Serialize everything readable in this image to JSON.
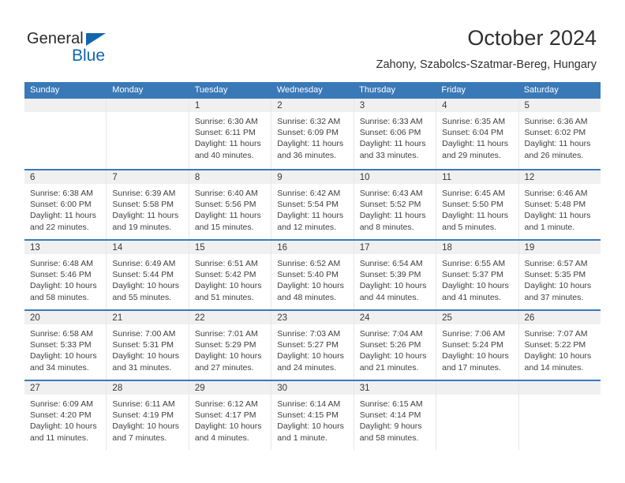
{
  "brand": {
    "name_part1": "General",
    "name_part2": "Blue"
  },
  "header": {
    "title": "October 2024",
    "subtitle": "Zahony, Szabolcs-Szatmar-Bereg, Hungary"
  },
  "calendar": {
    "weekdays": [
      "Sunday",
      "Monday",
      "Tuesday",
      "Wednesday",
      "Thursday",
      "Friday",
      "Saturday"
    ],
    "header_bg": "#3a79b8",
    "daynum_bg": "#f0f0f0",
    "weeks": [
      [
        {
          "day": "",
          "sunrise": "",
          "sunset": "",
          "daylight": ""
        },
        {
          "day": "",
          "sunrise": "",
          "sunset": "",
          "daylight": ""
        },
        {
          "day": "1",
          "sunrise": "Sunrise: 6:30 AM",
          "sunset": "Sunset: 6:11 PM",
          "daylight": "Daylight: 11 hours and 40 minutes."
        },
        {
          "day": "2",
          "sunrise": "Sunrise: 6:32 AM",
          "sunset": "Sunset: 6:09 PM",
          "daylight": "Daylight: 11 hours and 36 minutes."
        },
        {
          "day": "3",
          "sunrise": "Sunrise: 6:33 AM",
          "sunset": "Sunset: 6:06 PM",
          "daylight": "Daylight: 11 hours and 33 minutes."
        },
        {
          "day": "4",
          "sunrise": "Sunrise: 6:35 AM",
          "sunset": "Sunset: 6:04 PM",
          "daylight": "Daylight: 11 hours and 29 minutes."
        },
        {
          "day": "5",
          "sunrise": "Sunrise: 6:36 AM",
          "sunset": "Sunset: 6:02 PM",
          "daylight": "Daylight: 11 hours and 26 minutes."
        }
      ],
      [
        {
          "day": "6",
          "sunrise": "Sunrise: 6:38 AM",
          "sunset": "Sunset: 6:00 PM",
          "daylight": "Daylight: 11 hours and 22 minutes."
        },
        {
          "day": "7",
          "sunrise": "Sunrise: 6:39 AM",
          "sunset": "Sunset: 5:58 PM",
          "daylight": "Daylight: 11 hours and 19 minutes."
        },
        {
          "day": "8",
          "sunrise": "Sunrise: 6:40 AM",
          "sunset": "Sunset: 5:56 PM",
          "daylight": "Daylight: 11 hours and 15 minutes."
        },
        {
          "day": "9",
          "sunrise": "Sunrise: 6:42 AM",
          "sunset": "Sunset: 5:54 PM",
          "daylight": "Daylight: 11 hours and 12 minutes."
        },
        {
          "day": "10",
          "sunrise": "Sunrise: 6:43 AM",
          "sunset": "Sunset: 5:52 PM",
          "daylight": "Daylight: 11 hours and 8 minutes."
        },
        {
          "day": "11",
          "sunrise": "Sunrise: 6:45 AM",
          "sunset": "Sunset: 5:50 PM",
          "daylight": "Daylight: 11 hours and 5 minutes."
        },
        {
          "day": "12",
          "sunrise": "Sunrise: 6:46 AM",
          "sunset": "Sunset: 5:48 PM",
          "daylight": "Daylight: 11 hours and 1 minute."
        }
      ],
      [
        {
          "day": "13",
          "sunrise": "Sunrise: 6:48 AM",
          "sunset": "Sunset: 5:46 PM",
          "daylight": "Daylight: 10 hours and 58 minutes."
        },
        {
          "day": "14",
          "sunrise": "Sunrise: 6:49 AM",
          "sunset": "Sunset: 5:44 PM",
          "daylight": "Daylight: 10 hours and 55 minutes."
        },
        {
          "day": "15",
          "sunrise": "Sunrise: 6:51 AM",
          "sunset": "Sunset: 5:42 PM",
          "daylight": "Daylight: 10 hours and 51 minutes."
        },
        {
          "day": "16",
          "sunrise": "Sunrise: 6:52 AM",
          "sunset": "Sunset: 5:40 PM",
          "daylight": "Daylight: 10 hours and 48 minutes."
        },
        {
          "day": "17",
          "sunrise": "Sunrise: 6:54 AM",
          "sunset": "Sunset: 5:39 PM",
          "daylight": "Daylight: 10 hours and 44 minutes."
        },
        {
          "day": "18",
          "sunrise": "Sunrise: 6:55 AM",
          "sunset": "Sunset: 5:37 PM",
          "daylight": "Daylight: 10 hours and 41 minutes."
        },
        {
          "day": "19",
          "sunrise": "Sunrise: 6:57 AM",
          "sunset": "Sunset: 5:35 PM",
          "daylight": "Daylight: 10 hours and 37 minutes."
        }
      ],
      [
        {
          "day": "20",
          "sunrise": "Sunrise: 6:58 AM",
          "sunset": "Sunset: 5:33 PM",
          "daylight": "Daylight: 10 hours and 34 minutes."
        },
        {
          "day": "21",
          "sunrise": "Sunrise: 7:00 AM",
          "sunset": "Sunset: 5:31 PM",
          "daylight": "Daylight: 10 hours and 31 minutes."
        },
        {
          "day": "22",
          "sunrise": "Sunrise: 7:01 AM",
          "sunset": "Sunset: 5:29 PM",
          "daylight": "Daylight: 10 hours and 27 minutes."
        },
        {
          "day": "23",
          "sunrise": "Sunrise: 7:03 AM",
          "sunset": "Sunset: 5:27 PM",
          "daylight": "Daylight: 10 hours and 24 minutes."
        },
        {
          "day": "24",
          "sunrise": "Sunrise: 7:04 AM",
          "sunset": "Sunset: 5:26 PM",
          "daylight": "Daylight: 10 hours and 21 minutes."
        },
        {
          "day": "25",
          "sunrise": "Sunrise: 7:06 AM",
          "sunset": "Sunset: 5:24 PM",
          "daylight": "Daylight: 10 hours and 17 minutes."
        },
        {
          "day": "26",
          "sunrise": "Sunrise: 7:07 AM",
          "sunset": "Sunset: 5:22 PM",
          "daylight": "Daylight: 10 hours and 14 minutes."
        }
      ],
      [
        {
          "day": "27",
          "sunrise": "Sunrise: 6:09 AM",
          "sunset": "Sunset: 4:20 PM",
          "daylight": "Daylight: 10 hours and 11 minutes."
        },
        {
          "day": "28",
          "sunrise": "Sunrise: 6:11 AM",
          "sunset": "Sunset: 4:19 PM",
          "daylight": "Daylight: 10 hours and 7 minutes."
        },
        {
          "day": "29",
          "sunrise": "Sunrise: 6:12 AM",
          "sunset": "Sunset: 4:17 PM",
          "daylight": "Daylight: 10 hours and 4 minutes."
        },
        {
          "day": "30",
          "sunrise": "Sunrise: 6:14 AM",
          "sunset": "Sunset: 4:15 PM",
          "daylight": "Daylight: 10 hours and 1 minute."
        },
        {
          "day": "31",
          "sunrise": "Sunrise: 6:15 AM",
          "sunset": "Sunset: 4:14 PM",
          "daylight": "Daylight: 9 hours and 58 minutes."
        },
        {
          "day": "",
          "sunrise": "",
          "sunset": "",
          "daylight": ""
        },
        {
          "day": "",
          "sunrise": "",
          "sunset": "",
          "daylight": ""
        }
      ]
    ]
  }
}
